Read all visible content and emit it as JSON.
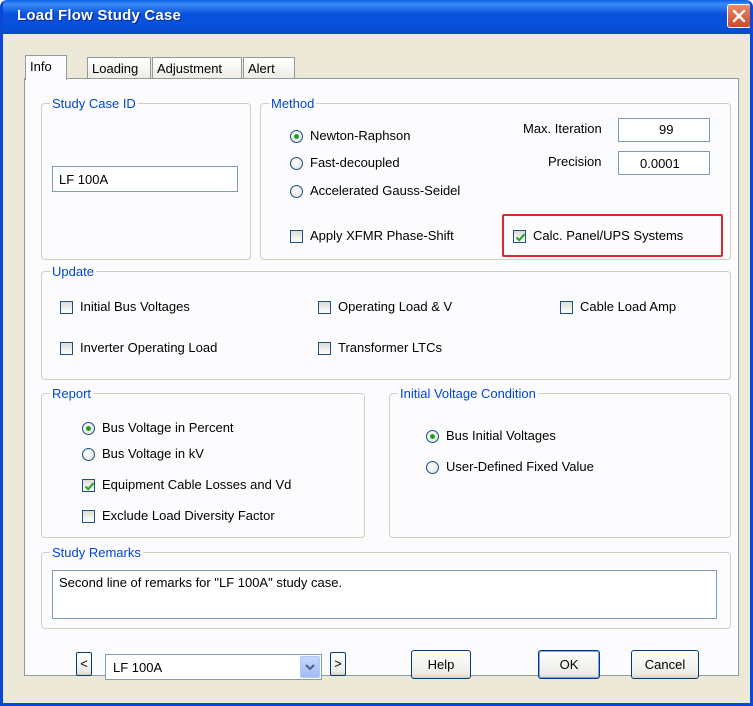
{
  "window": {
    "title": "Load Flow Study Case"
  },
  "tabs": [
    {
      "label": "Info",
      "active": true
    },
    {
      "label": "Loading",
      "active": false
    },
    {
      "label": "Adjustment",
      "active": false
    },
    {
      "label": "Alert",
      "active": false
    }
  ],
  "study_case_id": {
    "legend": "Study Case ID",
    "value": "LF 100A"
  },
  "method": {
    "legend": "Method",
    "options": [
      {
        "label": "Newton-Raphson",
        "selected": true
      },
      {
        "label": "Fast-decoupled",
        "selected": false
      },
      {
        "label": "Accelerated Gauss-Seidel",
        "selected": false
      }
    ],
    "max_iteration_label": "Max. Iteration",
    "max_iteration_value": "99",
    "precision_label": "Precision",
    "precision_value": "0.0001",
    "apply_xfmr_label": "Apply XFMR Phase-Shift",
    "apply_xfmr_checked": false,
    "calc_panel_label": "Calc. Panel/UPS Systems",
    "calc_panel_checked": true
  },
  "update": {
    "legend": "Update",
    "initial_bus_voltages": "Initial Bus Voltages",
    "operating_load_v": "Operating Load & V",
    "cable_load_amp": "Cable Load Amp",
    "inverter_operating_load": "Inverter Operating Load",
    "transformer_ltcs": "Transformer LTCs"
  },
  "report": {
    "legend": "Report",
    "bus_voltage_percent": "Bus Voltage in Percent",
    "bus_voltage_kv": "Bus Voltage in kV",
    "equipment_cable_losses": "Equipment Cable Losses and Vd",
    "exclude_load_diversity": "Exclude Load Diversity Factor",
    "selected": "Bus Voltage in Percent",
    "equipment_cable_losses_checked": true,
    "exclude_load_diversity_checked": false
  },
  "initial_voltage": {
    "legend": "Initial Voltage Condition",
    "bus_initial_voltages": "Bus Initial Voltages",
    "user_defined_fixed": "User-Defined Fixed Value",
    "selected": "Bus Initial Voltages"
  },
  "remarks": {
    "legend": "Study Remarks",
    "text": "Second line of remarks for \"LF 100A\" study case."
  },
  "footer": {
    "prev_symbol": "<",
    "next_symbol": ">",
    "combo_value": "LF 100A",
    "help_label": "Help",
    "ok_label": "OK",
    "cancel_label": "Cancel"
  },
  "colors": {
    "titlebar": "#0a53df",
    "legend_text": "#0046d5",
    "highlight": "#e0252b",
    "check_mark": "#21a121"
  }
}
